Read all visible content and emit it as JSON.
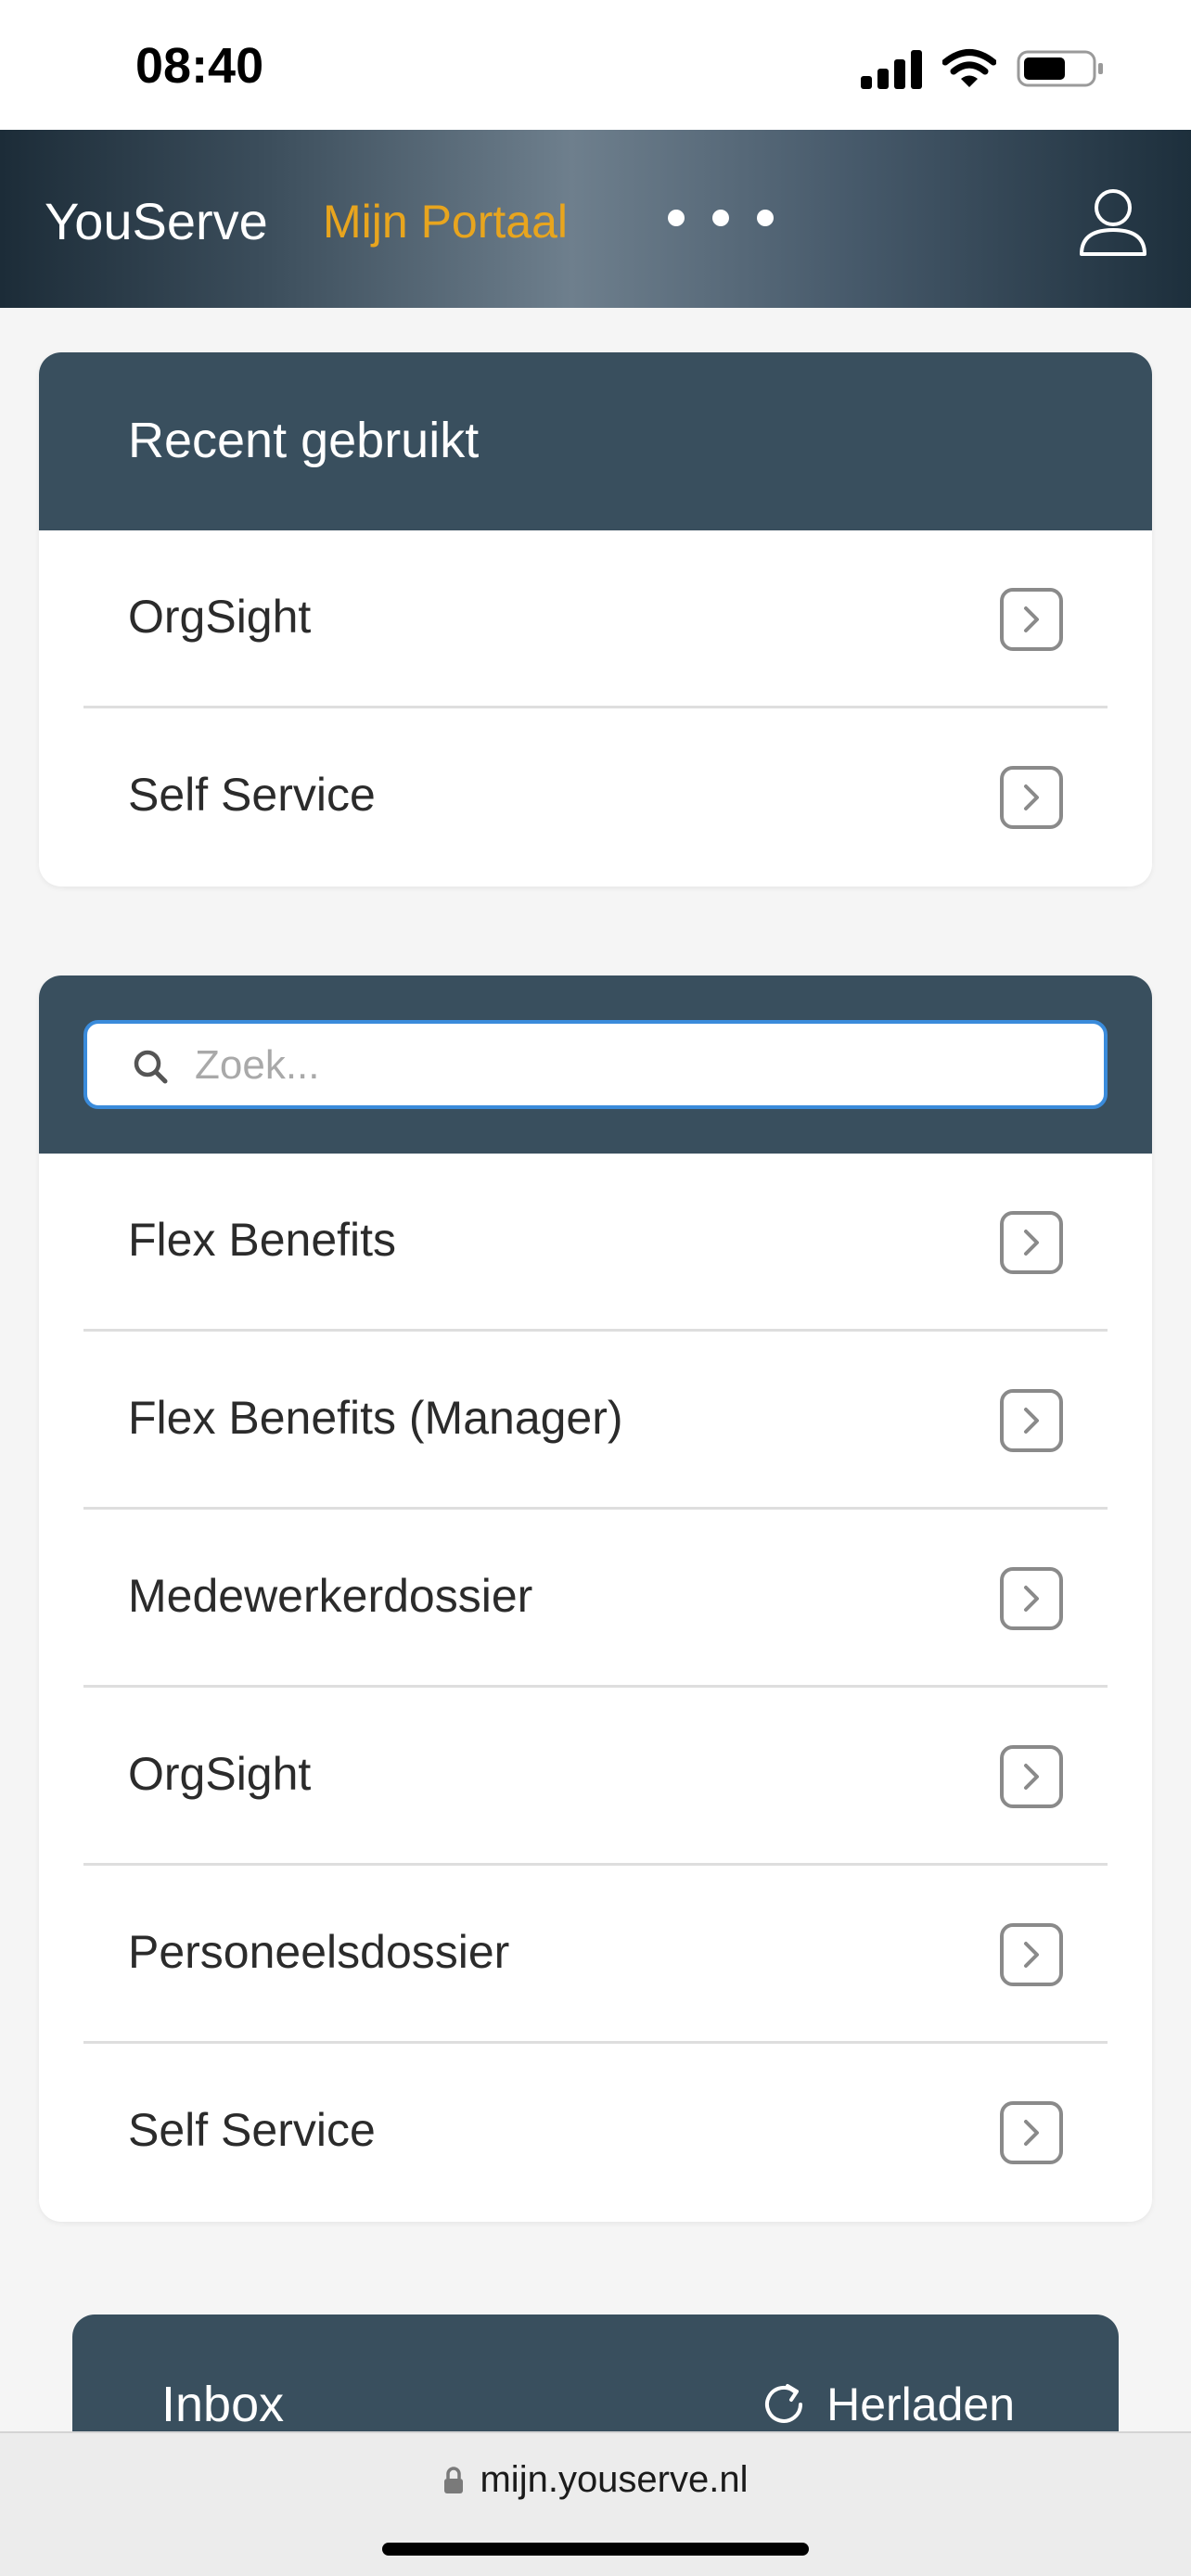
{
  "status_bar": {
    "time": "08:40"
  },
  "header": {
    "brand": "YouServe",
    "portal_link": "Mijn Portaal"
  },
  "recent": {
    "title": "Recent gebruikt",
    "items": [
      {
        "label": "OrgSight"
      },
      {
        "label": "Self Service"
      }
    ]
  },
  "apps": {
    "search_placeholder": "Zoek...",
    "items": [
      {
        "label": "Flex Benefits"
      },
      {
        "label": "Flex Benefits (Manager)"
      },
      {
        "label": "Medewerkerdossier"
      },
      {
        "label": "OrgSight"
      },
      {
        "label": "Personeelsdossier"
      },
      {
        "label": "Self Service"
      }
    ]
  },
  "inbox": {
    "title": "Inbox",
    "reload_label": "Herladen"
  },
  "browser": {
    "url": "mijn.youserve.nl"
  },
  "colors": {
    "accent": "#e8a51e",
    "card_header": "#394f5e",
    "search_focus": "#3a8bdb"
  }
}
